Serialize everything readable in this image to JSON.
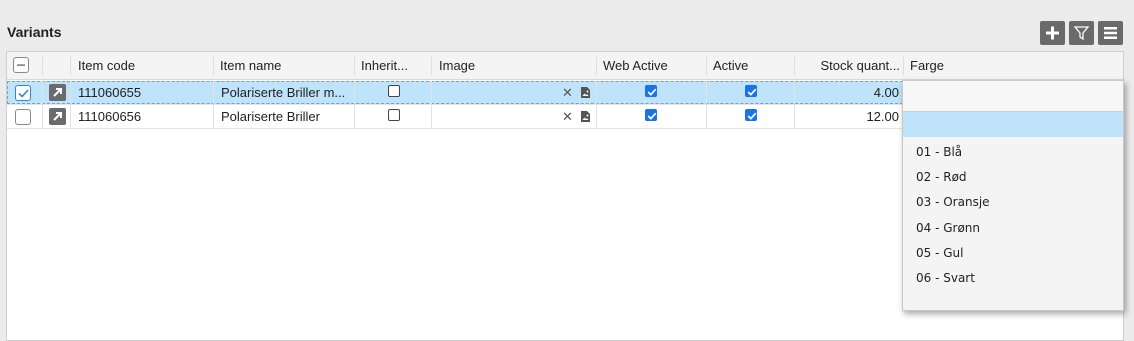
{
  "panel": {
    "title": "Variants"
  },
  "toolbar": {
    "add_icon": "plus-icon",
    "filter_icon": "filter-icon",
    "menu_icon": "hamburger-icon"
  },
  "grid": {
    "columns": [
      "Item code",
      "Item name",
      "Inherit...",
      "Image",
      "Web Active",
      "Active",
      "Stock quant...",
      "Farge"
    ],
    "rows": [
      {
        "selected": true,
        "item_code": "111060655",
        "item_name": "Polariserte Briller m...",
        "inherit": false,
        "web_active": true,
        "active": true,
        "stock": "4.00"
      },
      {
        "selected": false,
        "item_code": "111060656",
        "item_name": "Polariserte Briller",
        "inherit": false,
        "web_active": true,
        "active": true,
        "stock": "12.00"
      }
    ],
    "row_icon": "open-link-icon",
    "image_clear_icon": "close-icon",
    "image_file_icon": "image-file-icon"
  },
  "farge_dropdown": {
    "value": "",
    "options": [
      "",
      "01 - Blå",
      "02 - Rød",
      "03 - Oransje",
      "04 - Grønn",
      "05 - Gul",
      "06 - Svart"
    ],
    "highlighted_index": 0
  },
  "colors": {
    "selection": "#bfe3fb",
    "checkbox_blue": "#1a73e8",
    "toolbar_button": "#6a6a6a"
  }
}
